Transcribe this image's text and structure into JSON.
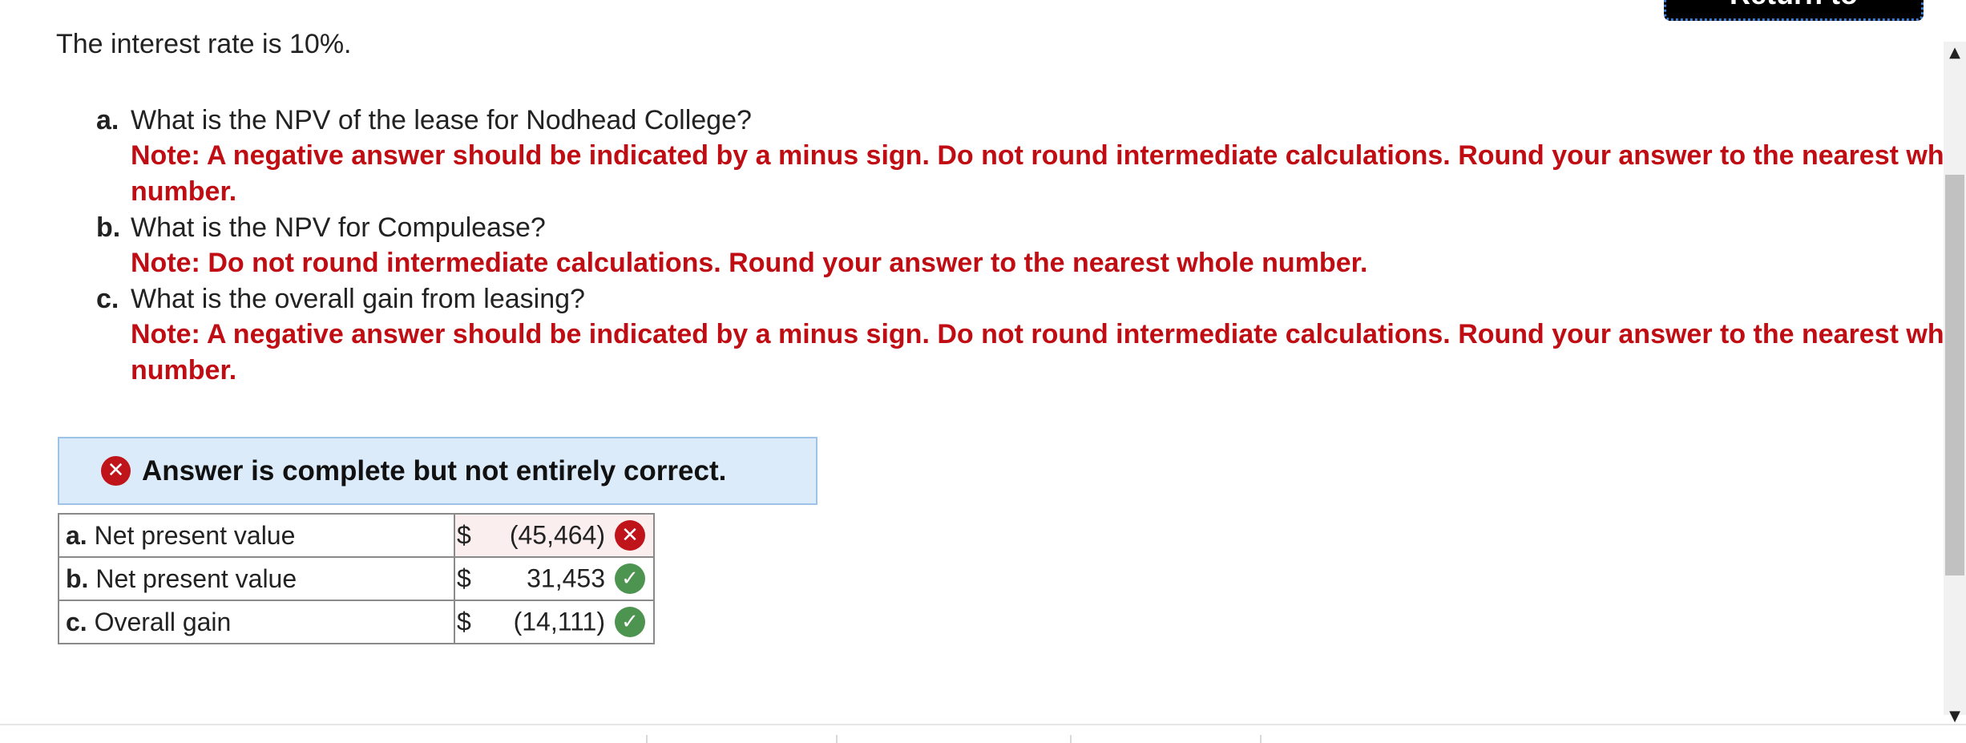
{
  "return_button": {
    "label": "Return to question"
  },
  "intro": "The interest rate is 10%.",
  "questions": [
    {
      "letter": "a.",
      "text": "What is the NPV of the lease for Nodhead College?",
      "note": "Note: A negative answer should be indicated by a minus sign. Do not round intermediate calculations. Round your answer to the nearest whole number."
    },
    {
      "letter": "b.",
      "text": "What is the NPV for Compulease?",
      "note": "Note: Do not round intermediate calculations. Round your answer to the nearest whole number."
    },
    {
      "letter": "c.",
      "text": "What is the overall gain from leasing?",
      "note": "Note: A negative answer should be indicated by a minus sign. Do not round intermediate calculations. Round your answer to the nearest whole number."
    }
  ],
  "answer_banner": {
    "icon": "x-circle-icon",
    "text": "Answer is complete but not entirely correct."
  },
  "answer_table": {
    "rows": [
      {
        "letter": "a.",
        "label": "Net present value",
        "currency": "$",
        "value": "(45,464)",
        "status": "incorrect",
        "mark": "✕"
      },
      {
        "letter": "b.",
        "label": "Net present value",
        "currency": "$",
        "value": "31,453",
        "status": "correct",
        "mark": "✓"
      },
      {
        "letter": "c.",
        "label": "Overall gain",
        "currency": "$",
        "value": "(14,111)",
        "status": "correct",
        "mark": "✓"
      }
    ]
  },
  "colors": {
    "note_red": "#c00d14",
    "banner_bg": "#dcebf9",
    "incorrect_red": "#c0141b",
    "correct_green": "#4d9450"
  },
  "scrollbar": {
    "up_glyph": "▲",
    "down_glyph": "▼"
  }
}
